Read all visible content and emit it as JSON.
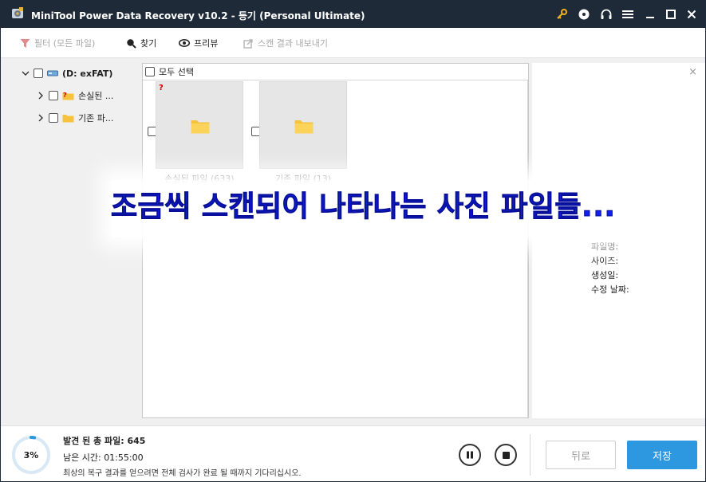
{
  "window": {
    "title": "MiniTool Power Data Recovery v10.2 - 등기 (Personal Ultimate)"
  },
  "titlebar_icons": [
    "key-icon",
    "disc-icon",
    "headset-icon",
    "menu-icon",
    "minimize-icon",
    "maximize-icon",
    "close-icon"
  ],
  "toolbar": {
    "filter_label": "필터 (모든 파일)",
    "find_label": "찾기",
    "preview_label": "프리뷰",
    "export_label": "스캔 결과 내보내기"
  },
  "tree": {
    "root_label": "(D: exFAT)",
    "items": [
      {
        "label": "손실된 ..."
      },
      {
        "label": "기존 파..."
      }
    ]
  },
  "content": {
    "select_all_label": "모두 선택",
    "lost_badge": "?",
    "tiles": [
      {
        "label": "손실된 파일 (633)"
      },
      {
        "label": "기존 파일 (13)"
      }
    ]
  },
  "preview": {
    "close_glyph": "×",
    "props": [
      "파일명:",
      "사이즈:",
      "생성일:",
      "수정 날짜:"
    ]
  },
  "caption": {
    "text": "조금씩 스캔되어 나타나는 사진 파일들..."
  },
  "status": {
    "progress_label": "3%",
    "progress_value": 0.03,
    "found_label": "발견 된 총 파일:",
    "found_count": "645",
    "remaining_label": "남은 시간:",
    "remaining_time": "01:55:00",
    "hint": "최상의 복구 결과를 얻으려면 전체 검사가 완료 될 때까지 기다리십시오."
  },
  "buttons": {
    "back_label": "뒤로",
    "save_label": "저장"
  },
  "colors": {
    "titlebar": "#1e2a38",
    "accent": "#2d97e0",
    "caption": "#1020ee",
    "folder": "#f7c23c"
  }
}
